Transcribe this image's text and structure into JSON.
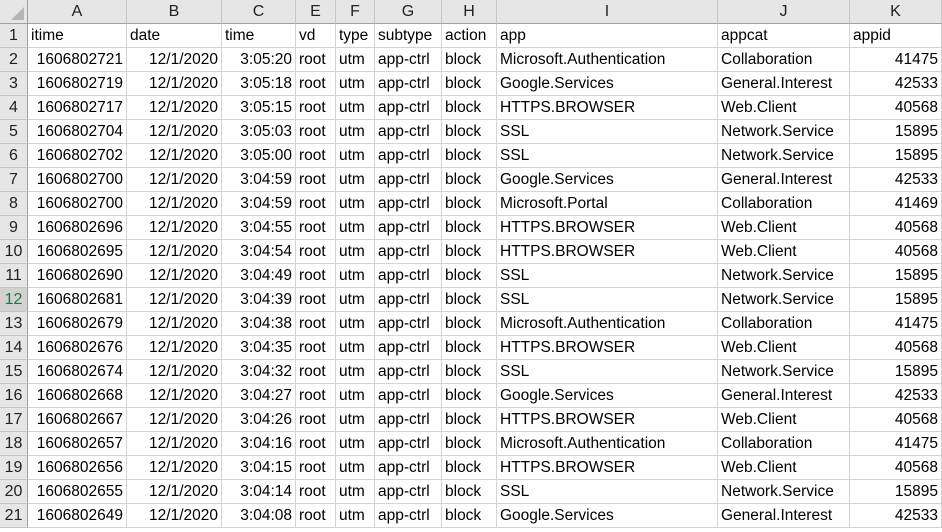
{
  "columns": [
    "A",
    "B",
    "C",
    "E",
    "F",
    "G",
    "H",
    "I",
    "J",
    "K"
  ],
  "active_row": 12,
  "rows": [
    {
      "n": "1",
      "cells": [
        "itime",
        "date",
        "time",
        "vd",
        "type",
        "subtype",
        "action",
        "app",
        "appcat",
        "appid"
      ]
    },
    {
      "n": "2",
      "cells": [
        "1606802721",
        "12/1/2020",
        "3:05:20",
        "root",
        "utm",
        "app-ctrl",
        "block",
        "Microsoft.Authentication",
        "Collaboration",
        "41475"
      ]
    },
    {
      "n": "3",
      "cells": [
        "1606802719",
        "12/1/2020",
        "3:05:18",
        "root",
        "utm",
        "app-ctrl",
        "block",
        "Google.Services",
        "General.Interest",
        "42533"
      ]
    },
    {
      "n": "4",
      "cells": [
        "1606802717",
        "12/1/2020",
        "3:05:15",
        "root",
        "utm",
        "app-ctrl",
        "block",
        "HTTPS.BROWSER",
        "Web.Client",
        "40568"
      ]
    },
    {
      "n": "5",
      "cells": [
        "1606802704",
        "12/1/2020",
        "3:05:03",
        "root",
        "utm",
        "app-ctrl",
        "block",
        "SSL",
        "Network.Service",
        "15895"
      ]
    },
    {
      "n": "6",
      "cells": [
        "1606802702",
        "12/1/2020",
        "3:05:00",
        "root",
        "utm",
        "app-ctrl",
        "block",
        "SSL",
        "Network.Service",
        "15895"
      ]
    },
    {
      "n": "7",
      "cells": [
        "1606802700",
        "12/1/2020",
        "3:04:59",
        "root",
        "utm",
        "app-ctrl",
        "block",
        "Google.Services",
        "General.Interest",
        "42533"
      ]
    },
    {
      "n": "8",
      "cells": [
        "1606802700",
        "12/1/2020",
        "3:04:59",
        "root",
        "utm",
        "app-ctrl",
        "block",
        "Microsoft.Portal",
        "Collaboration",
        "41469"
      ]
    },
    {
      "n": "9",
      "cells": [
        "1606802696",
        "12/1/2020",
        "3:04:55",
        "root",
        "utm",
        "app-ctrl",
        "block",
        "HTTPS.BROWSER",
        "Web.Client",
        "40568"
      ]
    },
    {
      "n": "10",
      "cells": [
        "1606802695",
        "12/1/2020",
        "3:04:54",
        "root",
        "utm",
        "app-ctrl",
        "block",
        "HTTPS.BROWSER",
        "Web.Client",
        "40568"
      ]
    },
    {
      "n": "11",
      "cells": [
        "1606802690",
        "12/1/2020",
        "3:04:49",
        "root",
        "utm",
        "app-ctrl",
        "block",
        "SSL",
        "Network.Service",
        "15895"
      ]
    },
    {
      "n": "12",
      "cells": [
        "1606802681",
        "12/1/2020",
        "3:04:39",
        "root",
        "utm",
        "app-ctrl",
        "block",
        "SSL",
        "Network.Service",
        "15895"
      ]
    },
    {
      "n": "13",
      "cells": [
        "1606802679",
        "12/1/2020",
        "3:04:38",
        "root",
        "utm",
        "app-ctrl",
        "block",
        "Microsoft.Authentication",
        "Collaboration",
        "41475"
      ]
    },
    {
      "n": "14",
      "cells": [
        "1606802676",
        "12/1/2020",
        "3:04:35",
        "root",
        "utm",
        "app-ctrl",
        "block",
        "HTTPS.BROWSER",
        "Web.Client",
        "40568"
      ]
    },
    {
      "n": "15",
      "cells": [
        "1606802674",
        "12/1/2020",
        "3:04:32",
        "root",
        "utm",
        "app-ctrl",
        "block",
        "SSL",
        "Network.Service",
        "15895"
      ]
    },
    {
      "n": "16",
      "cells": [
        "1606802668",
        "12/1/2020",
        "3:04:27",
        "root",
        "utm",
        "app-ctrl",
        "block",
        "Google.Services",
        "General.Interest",
        "42533"
      ]
    },
    {
      "n": "17",
      "cells": [
        "1606802667",
        "12/1/2020",
        "3:04:26",
        "root",
        "utm",
        "app-ctrl",
        "block",
        "HTTPS.BROWSER",
        "Web.Client",
        "40568"
      ]
    },
    {
      "n": "18",
      "cells": [
        "1606802657",
        "12/1/2020",
        "3:04:16",
        "root",
        "utm",
        "app-ctrl",
        "block",
        "Microsoft.Authentication",
        "Collaboration",
        "41475"
      ]
    },
    {
      "n": "19",
      "cells": [
        "1606802656",
        "12/1/2020",
        "3:04:15",
        "root",
        "utm",
        "app-ctrl",
        "block",
        "HTTPS.BROWSER",
        "Web.Client",
        "40568"
      ]
    },
    {
      "n": "20",
      "cells": [
        "1606802655",
        "12/1/2020",
        "3:04:14",
        "root",
        "utm",
        "app-ctrl",
        "block",
        "SSL",
        "Network.Service",
        "15895"
      ]
    },
    {
      "n": "21",
      "cells": [
        "1606802649",
        "12/1/2020",
        "3:04:08",
        "root",
        "utm",
        "app-ctrl",
        "block",
        "Google.Services",
        "General.Interest",
        "42533"
      ]
    }
  ]
}
